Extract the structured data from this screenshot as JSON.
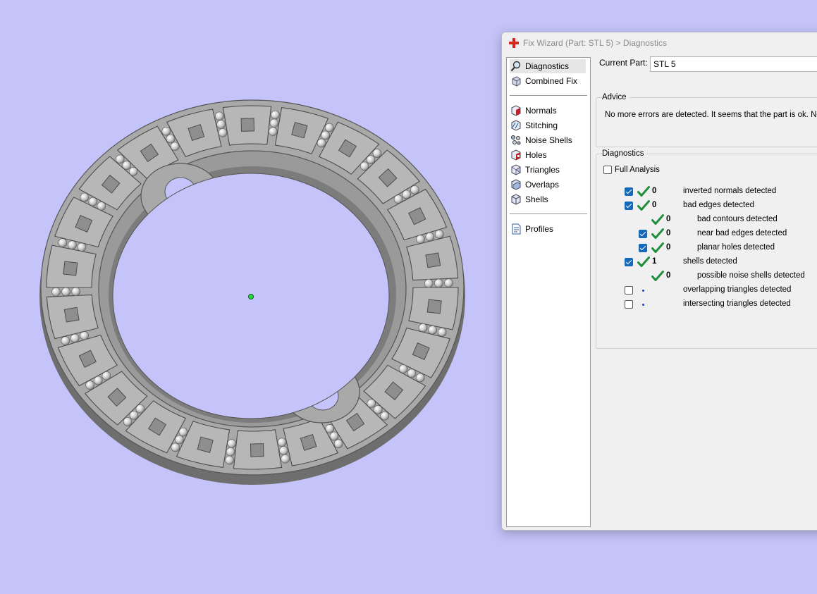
{
  "window": {
    "title": "Fix Wizard (Part: STL 5) > Diagnostics"
  },
  "nav": {
    "top_items": [
      {
        "label": "Diagnostics",
        "icon": "magnifier-icon",
        "selected": true
      },
      {
        "label": "Combined Fix",
        "icon": "cube-wizard-icon"
      }
    ],
    "fix_items": [
      {
        "label": "Normals",
        "icon": "normals-icon"
      },
      {
        "label": "Stitching",
        "icon": "stitching-icon"
      },
      {
        "label": "Noise Shells",
        "icon": "noise-shells-icon"
      },
      {
        "label": "Holes",
        "icon": "holes-icon"
      },
      {
        "label": "Triangles",
        "icon": "triangles-icon"
      },
      {
        "label": "Overlaps",
        "icon": "overlaps-icon"
      },
      {
        "label": "Shells",
        "icon": "shells-icon"
      }
    ],
    "bottom_items": [
      {
        "label": "Profiles",
        "icon": "profiles-icon"
      }
    ]
  },
  "current_part": {
    "label": "Current Part:",
    "value": "STL 5"
  },
  "advice": {
    "title": "Advice",
    "text": "No more errors are detected. It seems that the part is ok. No"
  },
  "diagnostics": {
    "title": "Diagnostics",
    "full_analysis_label": "Full Analysis",
    "full_analysis_checked": false,
    "rows": [
      {
        "checked": true,
        "status": "ok",
        "count": "0",
        "label": "inverted normals detected",
        "indent": 0,
        "has_checkbox": true
      },
      {
        "checked": true,
        "status": "ok",
        "count": "0",
        "label": "bad edges detected",
        "indent": 0,
        "has_checkbox": true
      },
      {
        "checked": false,
        "status": "ok",
        "count": "0",
        "label": "bad contours detected",
        "indent": 1,
        "has_checkbox": false
      },
      {
        "checked": true,
        "status": "ok",
        "count": "0",
        "label": "near bad edges detected",
        "indent": 1,
        "has_checkbox": true
      },
      {
        "checked": true,
        "status": "ok",
        "count": "0",
        "label": "planar holes detected",
        "indent": 1,
        "has_checkbox": true
      },
      {
        "checked": true,
        "status": "ok",
        "count": "1",
        "label": "shells detected",
        "indent": 0,
        "has_checkbox": true
      },
      {
        "checked": false,
        "status": "ok",
        "count": "0",
        "label": "possible noise shells detected",
        "indent": 1,
        "has_checkbox": false
      },
      {
        "checked": false,
        "status": "pending",
        "count": "",
        "label": "overlapping triangles detected",
        "indent": 0,
        "has_checkbox": true
      },
      {
        "checked": false,
        "status": "pending",
        "count": "",
        "label": "intersecting triangles detected",
        "indent": 0,
        "has_checkbox": true
      }
    ]
  },
  "colors": {
    "viewport_bg": "#c4c4fa",
    "part_gray": "#a9a9a9",
    "check_green": "#1f8f3a",
    "checkbox_blue": "#1668b8"
  }
}
